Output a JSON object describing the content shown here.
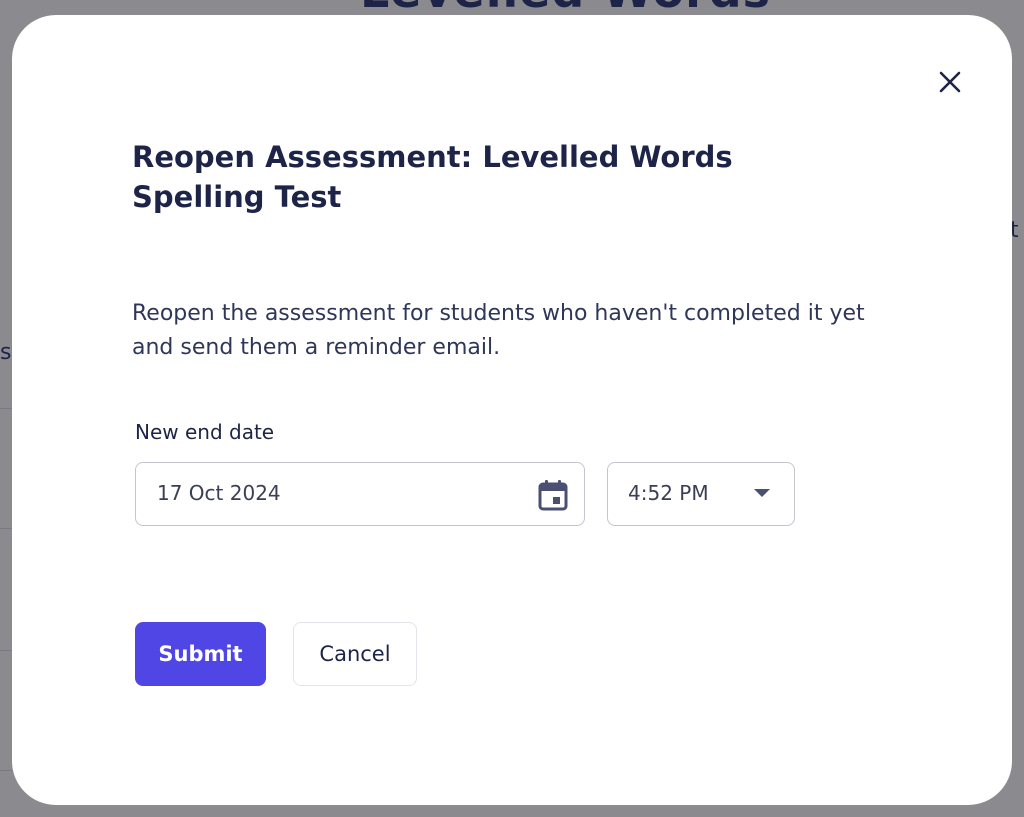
{
  "background": {
    "page_title": "Levelled Words",
    "edge_left": "s",
    "edge_right": "t"
  },
  "modal": {
    "title": "Reopen Assessment: Levelled Words Spelling Test",
    "description": "Reopen the assessment for students who haven't completed it yet and send them a reminder email.",
    "close_icon": "close-icon",
    "end_date": {
      "label": "New end date",
      "date_value": "17 Oct 2024",
      "date_icon": "calendar-icon",
      "time_value": "4:52 PM",
      "time_icon": "chevron-down-icon"
    },
    "actions": {
      "submit_label": "Submit",
      "cancel_label": "Cancel"
    }
  },
  "colors": {
    "primary": "#4f46e5",
    "heading": "#1d2448",
    "overlay": "#8b8b8f"
  }
}
